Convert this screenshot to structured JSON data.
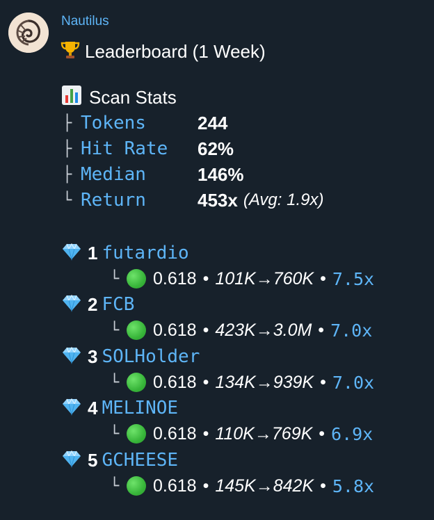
{
  "sender": "Nautilus",
  "title": {
    "icon": "trophy-icon",
    "text": "Leaderboard (1 Week)"
  },
  "stats": {
    "icon": "bar-chart-icon",
    "heading": "Scan Stats",
    "rows": [
      {
        "branch": "├",
        "key": "Tokens",
        "value": "244",
        "note": ""
      },
      {
        "branch": "├",
        "key": "Hit Rate",
        "value": "62%",
        "note": ""
      },
      {
        "branch": "├",
        "key": "Median",
        "value": "146%",
        "note": ""
      },
      {
        "branch": "└",
        "key": "Return",
        "value": "453x",
        "note": "(Avg: 1.9x)"
      }
    ]
  },
  "leaders": [
    {
      "rank": "1",
      "name": "futardio",
      "score": "0.618",
      "range": "101K→760K",
      "multiple": "7.5x"
    },
    {
      "rank": "2",
      "name": "FCB",
      "score": "0.618",
      "range": "423K→3.0M",
      "multiple": "7.0x"
    },
    {
      "rank": "3",
      "name": "SOLHolder",
      "score": "0.618",
      "range": "134K→939K",
      "multiple": "7.0x"
    },
    {
      "rank": "4",
      "name": "MELINOE",
      "score": "0.618",
      "range": "110K→769K",
      "multiple": "6.9x"
    },
    {
      "rank": "5",
      "name": "GCHEESE",
      "score": "0.618",
      "range": "145K→842K",
      "multiple": "5.8x"
    }
  ],
  "separator": "•",
  "colors": {
    "background": "#17212b",
    "link": "#5eb5f7",
    "status": "#38b53a"
  }
}
